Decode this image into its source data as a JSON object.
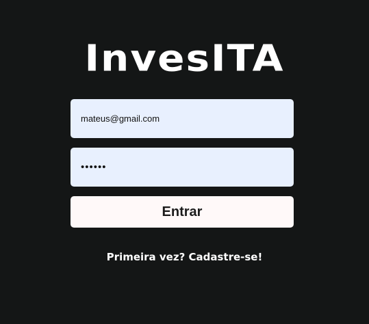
{
  "brand": {
    "logo_text": "InvesITA"
  },
  "login_form": {
    "email_value": "mateus@gmail.com",
    "password_value": "••••••",
    "submit_label": "Entrar",
    "signup_link": "Primeira vez? Cadastre-se!"
  },
  "colors": {
    "background": "#141616",
    "input_background": "#e8f0fe",
    "button_background": "#fff9f9",
    "text_light": "#ffffff"
  }
}
